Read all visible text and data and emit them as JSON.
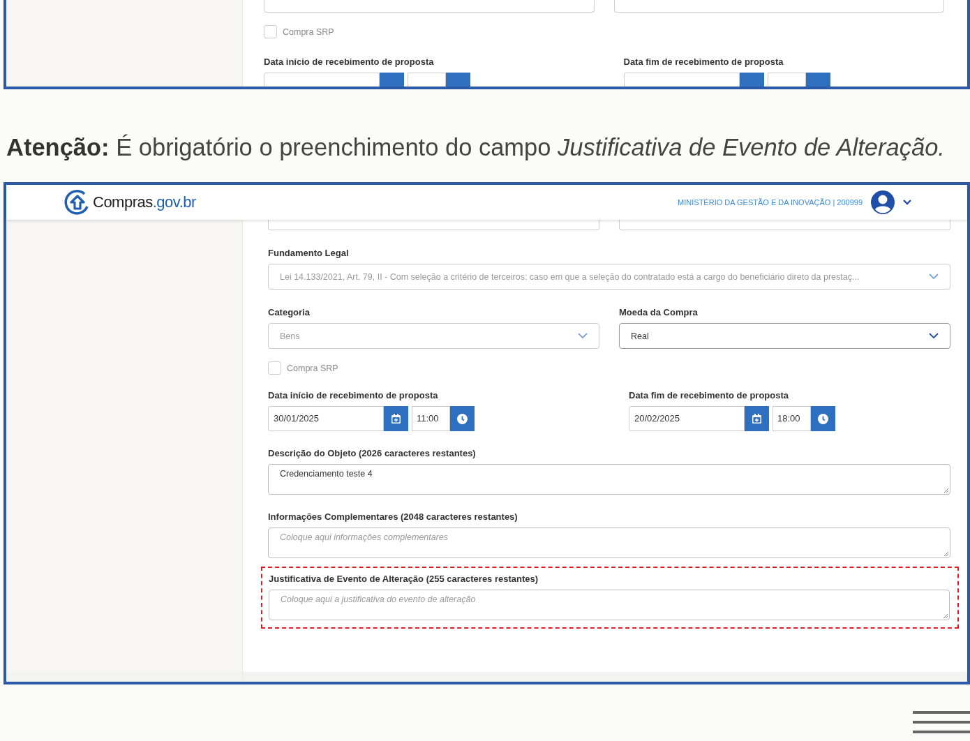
{
  "top_panel": {
    "srp": {
      "label": "Compra SRP",
      "checked": false
    },
    "start_label": "Data início de recebimento de proposta",
    "end_label": "Data fim de recebimento de proposta"
  },
  "note": "**Atenção:** É obrigatório o preenchimento do campo *Justificativa de Evento de Alteração.*",
  "header": {
    "logo_main": "Compras",
    "logo_domain": ".gov.br",
    "org_info": "MINISTÉRIO DA GESTÃO E DA INOVAÇÃO | 200999"
  },
  "form": {
    "legal_basis": {
      "label": "Fundamento Legal",
      "value": "Lei 14.133/2021, Art. 79, II - Com seleção a critério de terceiros: caso em que a seleção do contratado está a cargo do beneficiário direto da prestaç...",
      "disabled": true
    },
    "category": {
      "label": "Categoria",
      "value": "Bens",
      "disabled": true
    },
    "currency": {
      "label": "Moeda da Compra",
      "value": "Real",
      "disabled": false
    },
    "srp": {
      "label": "Compra SRP",
      "checked": false
    },
    "start": {
      "label": "Data início de recebimento de proposta",
      "date": "30/01/2025",
      "time": "11:00"
    },
    "end": {
      "label": "Data fim de recebimento de proposta",
      "date": "20/02/2025",
      "time": "18:00"
    },
    "textareas": [
      {
        "label": "Descrição do Objeto (2026 caracteres restantes)",
        "value": "Credenciamento teste 4",
        "highlighted": false
      },
      {
        "label": "Informações Complementares (2048 caracteres restantes)",
        "placeholder": "Coloque aqui informações complementares",
        "highlighted": false
      },
      {
        "label": "Justificativa de Evento de Alteração (255 caracteres restantes)",
        "placeholder": "Coloque aqui a justificativa do evento de alteração",
        "highlighted": true
      }
    ]
  }
}
